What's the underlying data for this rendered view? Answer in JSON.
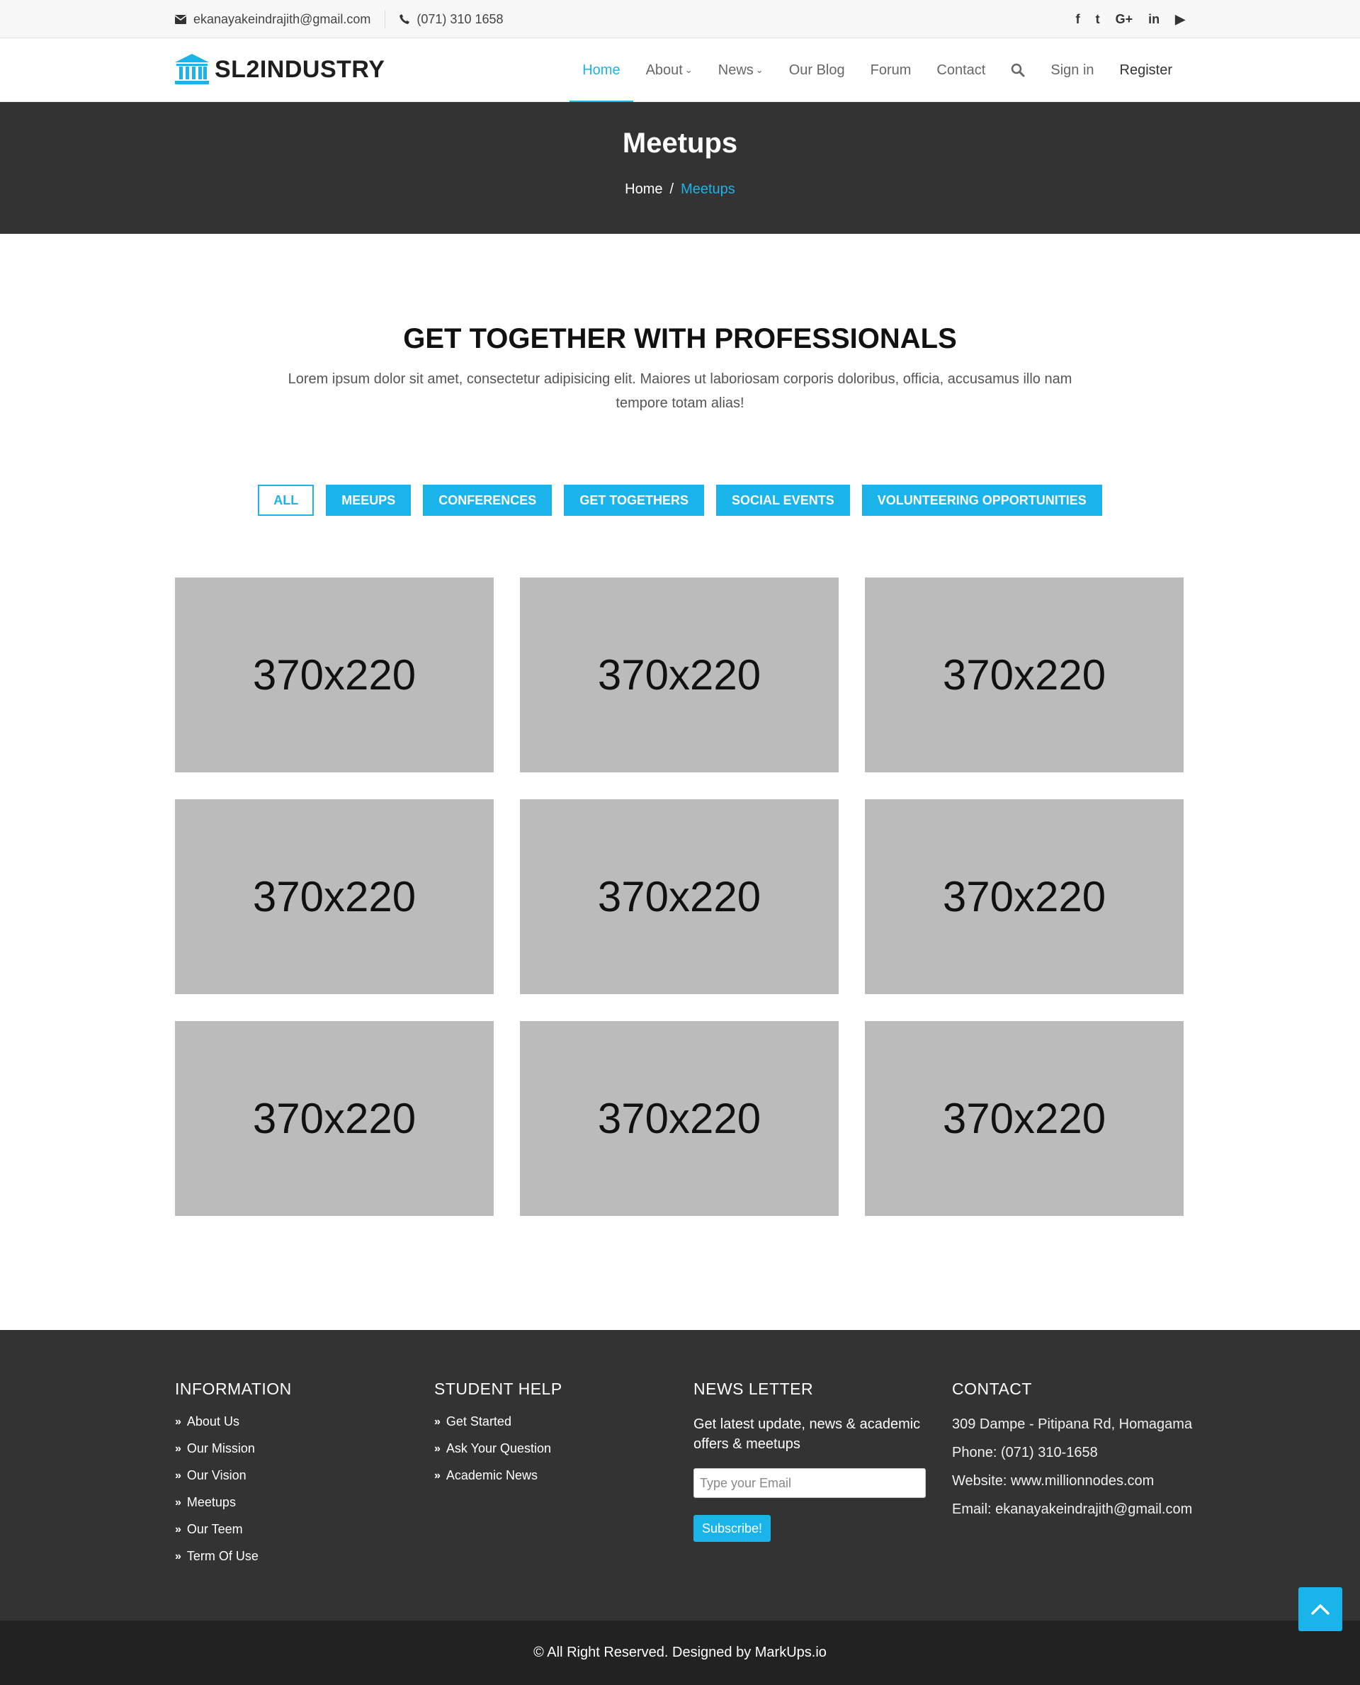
{
  "topbar": {
    "email": "ekanayakeindrajith@gmail.com",
    "phone": "(071) 310 1658",
    "social": [
      {
        "icon": "facebook-icon",
        "glyph": "f"
      },
      {
        "icon": "twitter-icon",
        "glyph": "t"
      },
      {
        "icon": "google-plus-icon",
        "glyph": "G+"
      },
      {
        "icon": "linkedin-icon",
        "glyph": "in"
      },
      {
        "icon": "youtube-icon",
        "glyph": "▶"
      }
    ]
  },
  "header": {
    "logo_text": "SL2INDUSTRY",
    "nav": {
      "home": "Home",
      "about": "About",
      "news": "News",
      "blog": "Our Blog",
      "forum": "Forum",
      "contact": "Contact",
      "signin": "Sign in",
      "register": "Register"
    },
    "accent_color": "#1ab4ea"
  },
  "banner": {
    "title": "Meetups",
    "crumb_home": "Home",
    "crumb_separator": "/",
    "crumb_current": "Meetups"
  },
  "intro": {
    "title": "GET TOGETHER WITH PROFESSIONALS",
    "text": "Lorem ipsum dolor sit amet, consectetur adipisicing elit. Maiores ut laboriosam corporis doloribus, officia, accusamus illo nam tempore totam alias!"
  },
  "filters": [
    "ALL",
    "MEEUPS",
    "CONFERENCES",
    "GET TOGETHERS",
    "SOCIAL EVENTS",
    "VOLUNTEERING OPPORTUNITIES"
  ],
  "gallery": [
    "370x220",
    "370x220",
    "370x220",
    "370x220",
    "370x220",
    "370x220",
    "370x220",
    "370x220",
    "370x220"
  ],
  "footer": {
    "information": {
      "title": "INFORMATION",
      "links": [
        "About Us",
        "Our Mission",
        "Our Vision",
        "Meetups",
        "Our Teem",
        "Term Of Use"
      ]
    },
    "student_help": {
      "title": "STUDENT HELP",
      "links": [
        "Get Started",
        "Ask Your Question",
        "Academic News"
      ]
    },
    "newsletter": {
      "title": "NEWS LETTER",
      "text": "Get latest update, news & academic offers & meetups",
      "placeholder": "Type your Email",
      "button": "Subscribe!"
    },
    "contact": {
      "title": "CONTACT",
      "address": "309 Dampe - Pitipana Rd, Homagama",
      "phone": "Phone: (071) 310-1658",
      "website": "Website: www.millionnodes.com",
      "email": "Email: ekanayakeindrajith@gmail.com"
    },
    "copyright": "© All Right Reserved. Designed by MarkUps.io"
  }
}
